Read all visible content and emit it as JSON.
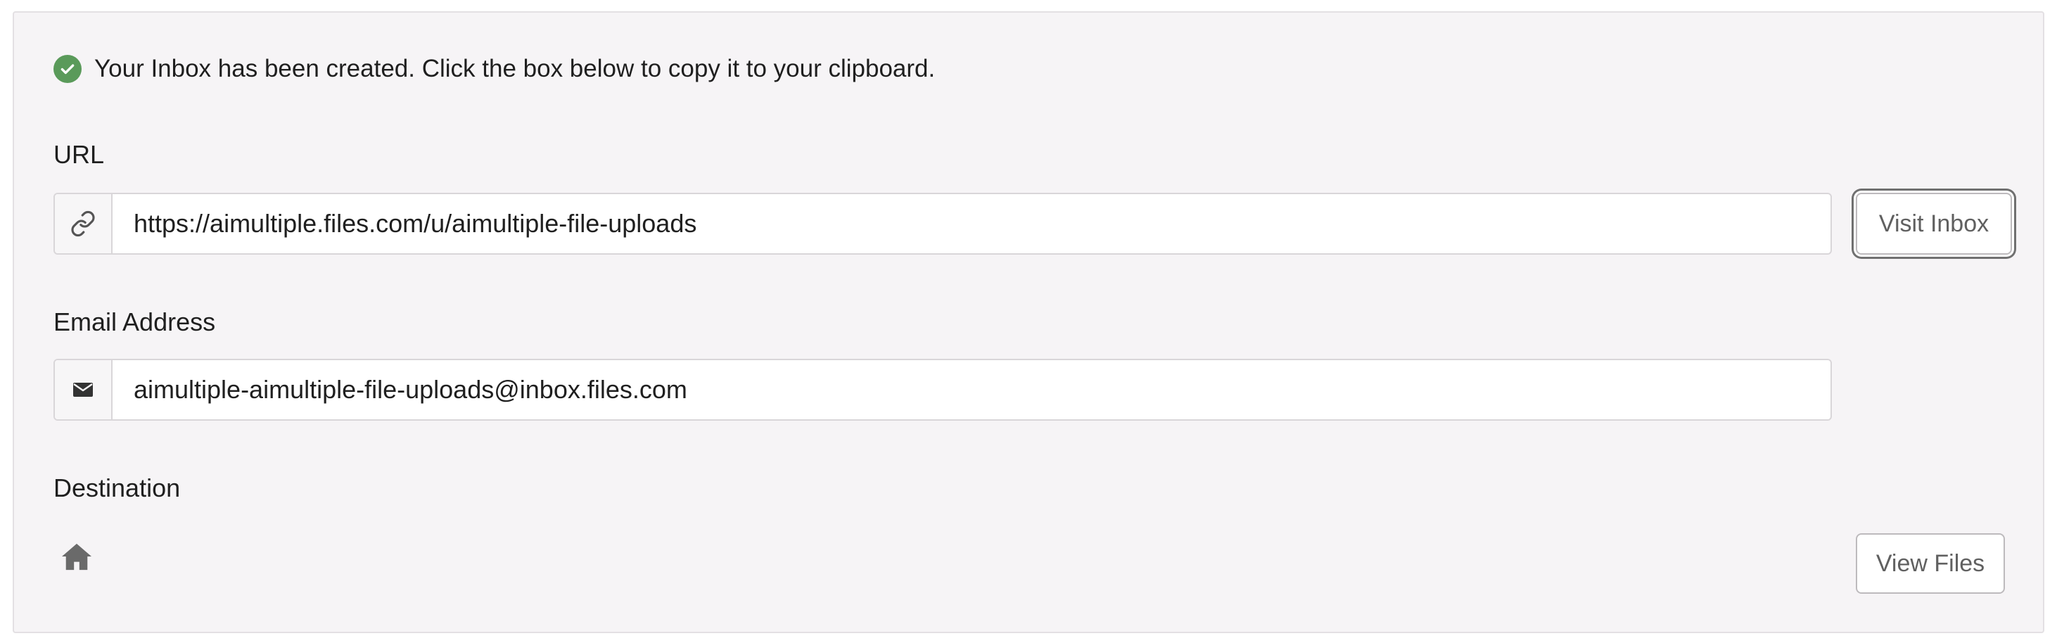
{
  "success_message": "Your Inbox has been created. Click the box below to copy it to your clipboard.",
  "url_section": {
    "label": "URL",
    "value": "https://aimultiple.files.com/u/aimultiple-file-uploads",
    "icon": "link-icon",
    "button_label": "Visit Inbox"
  },
  "email_section": {
    "label": "Email Address",
    "value": "aimultiple-aimultiple-file-uploads@inbox.files.com",
    "icon": "envelope-icon"
  },
  "destination_section": {
    "label": "Destination",
    "icon": "home-icon",
    "button_label": "View Files"
  },
  "colors": {
    "success": "#5a9a5a",
    "panel_background": "#f6f4f6",
    "button_text": "#606060"
  }
}
